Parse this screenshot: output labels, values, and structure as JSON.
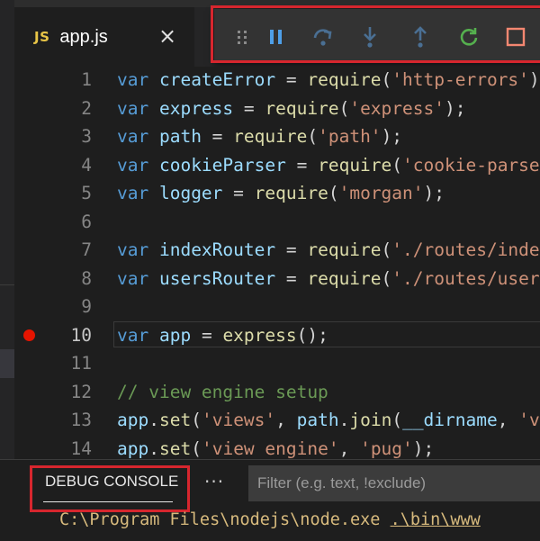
{
  "tab": {
    "badge": "JS",
    "title": "app.js",
    "close": "×"
  },
  "debug_toolbar": {
    "buttons": [
      {
        "name": "drag-handle",
        "icon": "gripper-icon",
        "color": "#8a8a8a"
      },
      {
        "name": "pause",
        "icon": "pause-icon",
        "color": "#4e9fe8"
      },
      {
        "name": "step-over",
        "icon": "step-over-icon",
        "color": "#4a6f93"
      },
      {
        "name": "step-into",
        "icon": "step-into-icon",
        "color": "#4a6f93"
      },
      {
        "name": "step-out",
        "icon": "step-out-icon",
        "color": "#4a6f93"
      },
      {
        "name": "restart",
        "icon": "restart-icon",
        "color": "#55b04e"
      },
      {
        "name": "stop",
        "icon": "stop-icon",
        "color": "#f48771"
      }
    ]
  },
  "editor": {
    "breakpoint_line": 10,
    "lines": [
      {
        "num": "1",
        "tokens": [
          [
            "kw",
            "var "
          ],
          [
            "id",
            "createError"
          ],
          [
            "op",
            " = "
          ],
          [
            "fn",
            "require"
          ],
          [
            "op",
            "("
          ],
          [
            "str",
            "'http-errors'"
          ],
          [
            "op",
            ");"
          ]
        ]
      },
      {
        "num": "2",
        "tokens": [
          [
            "kw",
            "var "
          ],
          [
            "id",
            "express"
          ],
          [
            "op",
            " = "
          ],
          [
            "fn",
            "require"
          ],
          [
            "op",
            "("
          ],
          [
            "str",
            "'express'"
          ],
          [
            "op",
            ");"
          ]
        ]
      },
      {
        "num": "3",
        "tokens": [
          [
            "kw",
            "var "
          ],
          [
            "id",
            "path"
          ],
          [
            "op",
            " = "
          ],
          [
            "fn",
            "require"
          ],
          [
            "op",
            "("
          ],
          [
            "str",
            "'path'"
          ],
          [
            "op",
            ");"
          ]
        ]
      },
      {
        "num": "4",
        "tokens": [
          [
            "kw",
            "var "
          ],
          [
            "id",
            "cookieParser"
          ],
          [
            "op",
            " = "
          ],
          [
            "fn",
            "require"
          ],
          [
            "op",
            "("
          ],
          [
            "str",
            "'cookie-parser'"
          ],
          [
            "op",
            ");"
          ]
        ]
      },
      {
        "num": "5",
        "tokens": [
          [
            "kw",
            "var "
          ],
          [
            "id",
            "logger"
          ],
          [
            "op",
            " = "
          ],
          [
            "fn",
            "require"
          ],
          [
            "op",
            "("
          ],
          [
            "str",
            "'morgan'"
          ],
          [
            "op",
            ");"
          ]
        ]
      },
      {
        "num": "6",
        "tokens": []
      },
      {
        "num": "7",
        "tokens": [
          [
            "kw",
            "var "
          ],
          [
            "id",
            "indexRouter"
          ],
          [
            "op",
            " = "
          ],
          [
            "fn",
            "require"
          ],
          [
            "op",
            "("
          ],
          [
            "str",
            "'./routes/index'"
          ],
          [
            "op",
            ");"
          ]
        ]
      },
      {
        "num": "8",
        "tokens": [
          [
            "kw",
            "var "
          ],
          [
            "id",
            "usersRouter"
          ],
          [
            "op",
            " = "
          ],
          [
            "fn",
            "require"
          ],
          [
            "op",
            "("
          ],
          [
            "str",
            "'./routes/users'"
          ],
          [
            "op",
            ");"
          ]
        ]
      },
      {
        "num": "9",
        "tokens": []
      },
      {
        "num": "10",
        "tokens": [
          [
            "kw",
            "var "
          ],
          [
            "id",
            "app"
          ],
          [
            "op",
            " = "
          ],
          [
            "fn",
            "express"
          ],
          [
            "op",
            "();"
          ]
        ]
      },
      {
        "num": "11",
        "tokens": []
      },
      {
        "num": "12",
        "tokens": [
          [
            "cm",
            "// view engine setup"
          ]
        ]
      },
      {
        "num": "13",
        "tokens": [
          [
            "id",
            "app"
          ],
          [
            "op",
            "."
          ],
          [
            "fn",
            "set"
          ],
          [
            "op",
            "("
          ],
          [
            "str",
            "'views'"
          ],
          [
            "op",
            ", "
          ],
          [
            "id",
            "path"
          ],
          [
            "op",
            "."
          ],
          [
            "fn",
            "join"
          ],
          [
            "op",
            "("
          ],
          [
            "id",
            "__dirname"
          ],
          [
            "op",
            ", "
          ],
          [
            "str",
            "'views'"
          ],
          [
            "op",
            "));"
          ]
        ]
      },
      {
        "num": "14",
        "tokens": [
          [
            "id",
            "app"
          ],
          [
            "op",
            "."
          ],
          [
            "fn",
            "set"
          ],
          [
            "op",
            "("
          ],
          [
            "str",
            "'view engine'"
          ],
          [
            "op",
            ", "
          ],
          [
            "str",
            "'pug'"
          ],
          [
            "op",
            ");"
          ]
        ]
      }
    ]
  },
  "panel": {
    "tab_label": "DEBUG CONSOLE",
    "more": "···",
    "filter_placeholder": "Filter (e.g. text, !exclude)",
    "console_prefix": "C:\\Program Files\\nodejs\\node.exe ",
    "console_link": ".\\bin\\www"
  },
  "colors": {
    "highlight_outline": "#d7262e",
    "breakpoint": "#e51400",
    "console_text": "#d7ba7d"
  }
}
